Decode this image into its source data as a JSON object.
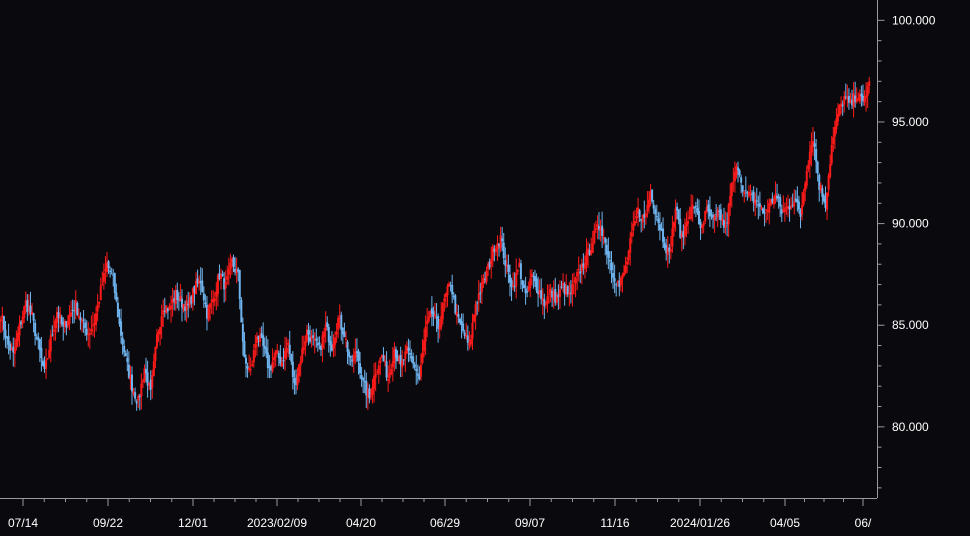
{
  "chart_data": {
    "type": "candlestick",
    "title": "",
    "xlabel": "",
    "ylabel": "",
    "ylim": [
      76.5,
      101.0
    ],
    "y_ticks": [
      {
        "value": 80,
        "label": "80.000"
      },
      {
        "value": 85,
        "label": "85.000"
      },
      {
        "value": 90,
        "label": "90.000"
      },
      {
        "value": 95,
        "label": "95.000"
      },
      {
        "value": 100,
        "label": "100.000"
      }
    ],
    "x_tick_labels": [
      "07/14",
      "09/22",
      "12/01",
      "2023/02/09",
      "04/20",
      "06/29",
      "09/07",
      "11/16",
      "2024/01/26",
      "04/05",
      "06/"
    ],
    "grid": false,
    "legend": "none",
    "colors": {
      "background": "#0a0a0e",
      "up": "#ff1a1a",
      "down": "#6fb4ee",
      "axis": "#9a9a9a",
      "text": "#ffffff"
    },
    "closes": [
      85.6,
      84.2,
      83.5,
      84.9,
      86.1,
      85.4,
      84.0,
      82.6,
      84.3,
      85.7,
      84.8,
      85.5,
      86.0,
      85.1,
      84.6,
      85.2,
      86.7,
      88.0,
      87.2,
      85.0,
      83.3,
      82.0,
      81.2,
      82.9,
      81.6,
      84.4,
      86.0,
      85.8,
      86.5,
      86.1,
      85.9,
      86.8,
      87.2,
      85.6,
      86.3,
      87.5,
      86.9,
      88.1,
      87.4,
      83.2,
      82.7,
      84.6,
      83.9,
      82.8,
      83.6,
      83.2,
      84.1,
      82.0,
      83.4,
      84.7,
      84.2,
      83.8,
      84.9,
      84.0,
      85.3,
      84.6,
      83.1,
      83.7,
      82.1,
      81.4,
      82.8,
      83.5,
      82.4,
      83.9,
      82.9,
      83.7,
      83.2,
      82.3,
      84.8,
      85.6,
      84.9,
      86.2,
      87.1,
      85.4,
      84.7,
      83.9,
      86.1,
      86.9,
      87.8,
      88.9,
      89.3,
      87.7,
      86.9,
      87.9,
      86.3,
      87.4,
      86.8,
      86.1,
      86.6,
      86.3,
      86.9,
      86.4,
      87.2,
      87.9,
      88.5,
      89.4,
      90.0,
      88.7,
      87.6,
      86.9,
      87.8,
      89.4,
      90.6,
      90.2,
      91.6,
      90.4,
      89.3,
      88.4,
      90.8,
      89.2,
      90.4,
      90.9,
      89.8,
      90.6,
      90.1,
      90.5,
      89.7,
      91.8,
      92.9,
      91.5,
      91.3,
      91.1,
      90.5,
      90.9,
      91.4,
      90.6,
      90.8,
      91.2,
      90.4,
      92.8,
      94.3,
      91.9,
      91.0,
      93.8,
      95.4,
      96.2,
      95.8,
      96.4,
      95.9,
      97.0
    ]
  }
}
